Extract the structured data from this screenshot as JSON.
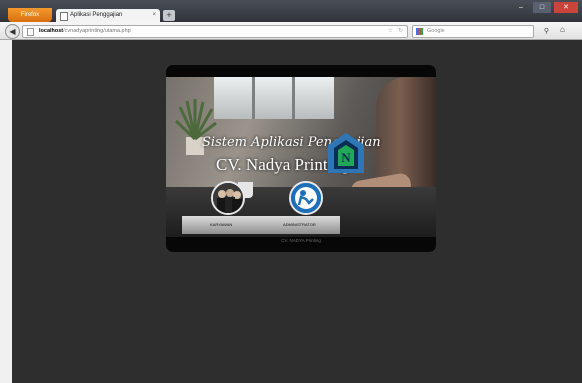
{
  "browser": {
    "app_button": "Firefox",
    "tab_title": "Aplikasi Penggajian",
    "tab_close": "×",
    "new_tab": "+",
    "window_controls": [
      "–",
      "□",
      "✕"
    ],
    "url_host": "localhost",
    "url_path": "/cvnadyaprinting/utama.php",
    "search_placeholder": "Google",
    "back_glyph": "◀"
  },
  "page": {
    "title_line1": "Sistem Aplikasi Penggajian",
    "title_line2": "CV. Nadya Printing",
    "menu": [
      {
        "label": "KARYAWAN"
      },
      {
        "label": "ADMINISTRATOR"
      }
    ],
    "footer": "CV. NADYA Printing",
    "logo_text": "N",
    "colors": {
      "background": "#2e2e2e",
      "card": "#070707",
      "logo_green": "#1fa855",
      "logo_blue": "#2f76b7"
    }
  }
}
